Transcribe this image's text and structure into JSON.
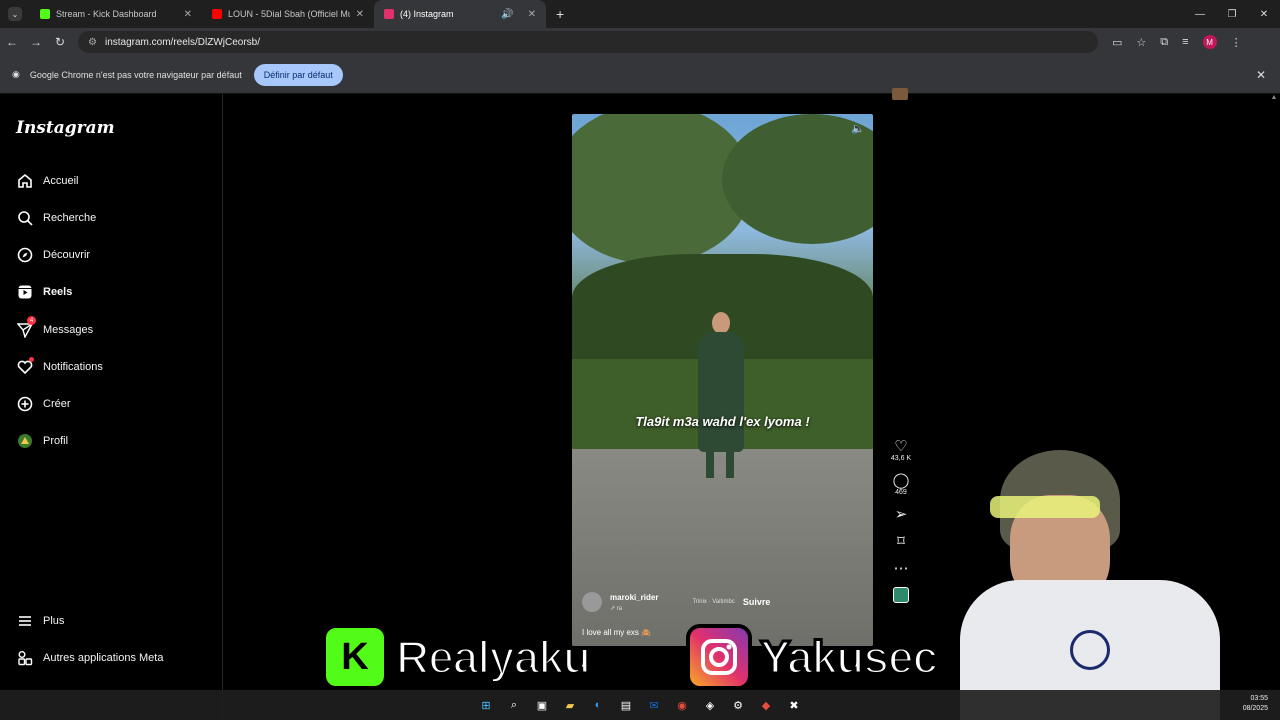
{
  "browser": {
    "tabs": [
      {
        "title": "Stream - Kick Dashboard",
        "favicon_color": "#53fc18",
        "active": false
      },
      {
        "title": "LOUN - 5Dial Sbah (Officiel Mu",
        "favicon_color": "#ff0000",
        "active": false
      },
      {
        "title": "(4) Instagram",
        "favicon_color": "#e1306c",
        "active": true
      }
    ],
    "url": "instagram.com/reels/DlZWjCeorsb/",
    "profile_initial": "M",
    "infobar": {
      "message": "Google Chrome n'est pas votre navigateur par défaut",
      "button": "Définir par défaut"
    }
  },
  "instagram": {
    "logo": "Instagram",
    "nav": [
      {
        "label": "Accueil",
        "icon": "home-icon"
      },
      {
        "label": "Recherche",
        "icon": "search-icon"
      },
      {
        "label": "Découvrir",
        "icon": "compass-icon"
      },
      {
        "label": "Reels",
        "icon": "reels-icon"
      },
      {
        "label": "Messages",
        "icon": "messenger-icon",
        "badge": "4"
      },
      {
        "label": "Notifications",
        "icon": "heart-icon"
      },
      {
        "label": "Créer",
        "icon": "plus-square-icon"
      },
      {
        "label": "Profil",
        "icon": "profile-icon"
      }
    ],
    "footer_nav": [
      {
        "label": "Plus",
        "icon": "menu-icon"
      },
      {
        "label": "Autres applications Meta",
        "icon": "meta-apps-icon"
      }
    ],
    "reel": {
      "caption_overlay": "Tla9it m3a wahd l'ex lyoma !",
      "username": "maroki_rider",
      "audio_prefix": "↗ ra",
      "audio": "Trinix · Vaitimbc",
      "follow": "Suivre",
      "description": "I love all my exs 🙈",
      "likes": "43,6 K",
      "comments": "469"
    }
  },
  "stream_overlay": {
    "kick_name": "Realyaku",
    "instagram_name": "Yakusec",
    "kick_color": "#53fc18"
  },
  "taskbar": {
    "time": "03:55",
    "date": "08/2025"
  }
}
